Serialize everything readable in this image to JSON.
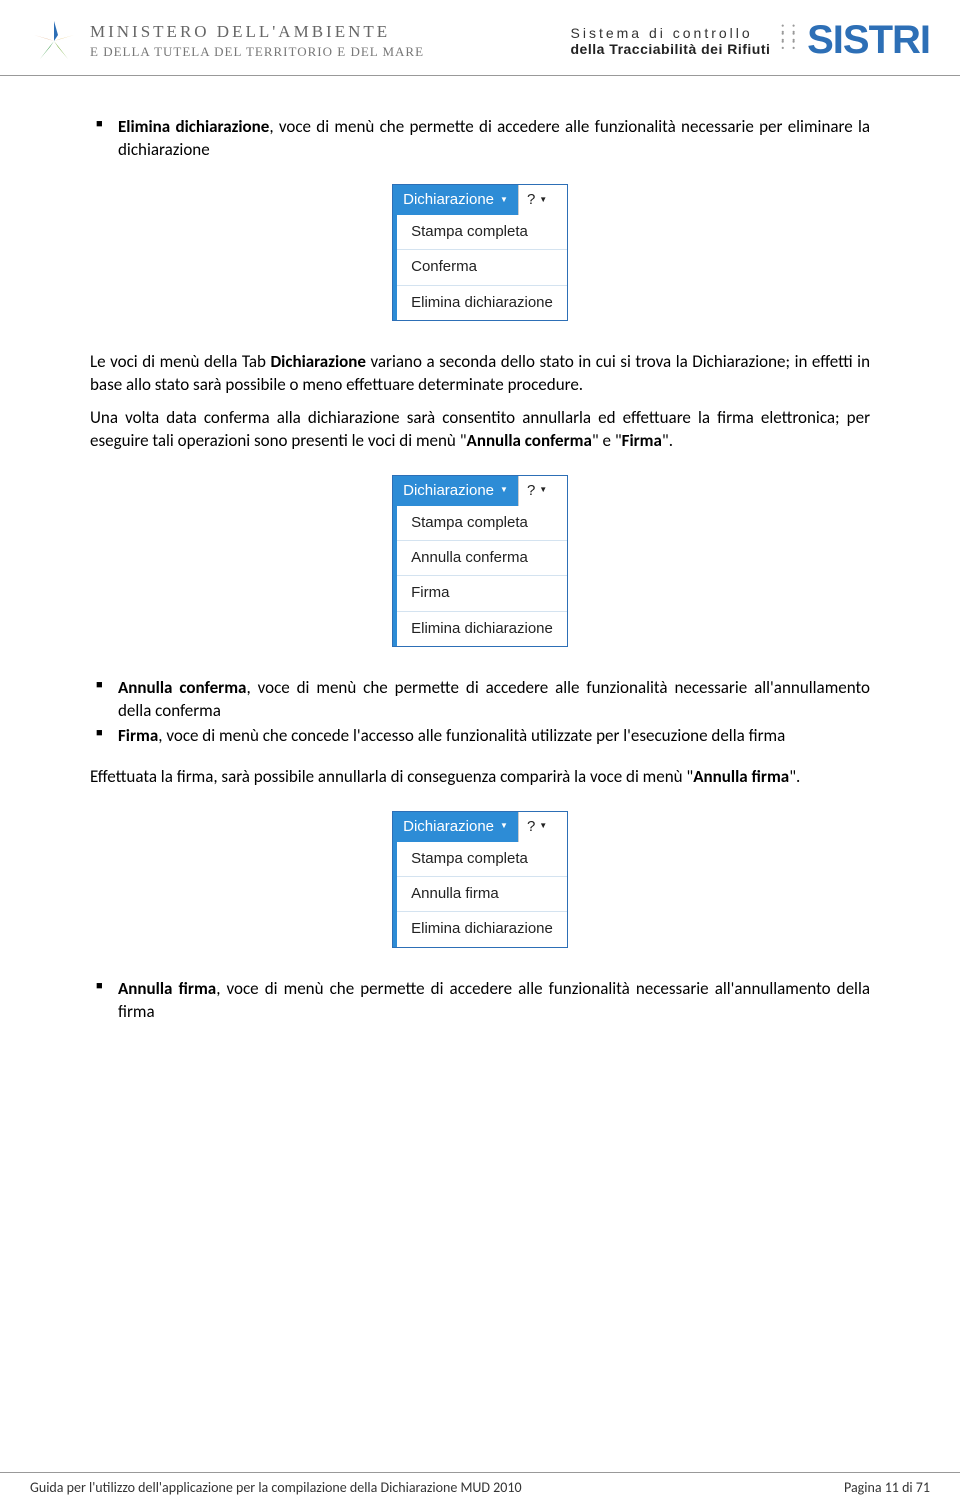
{
  "header": {
    "ministry_line1": "MINISTERO DELL'AMBIENTE",
    "ministry_line2": "E DELLA TUTELA DEL TERRITORIO E DEL MARE",
    "sistri_sub1": "Sistema di controllo",
    "sistri_sub2": "della Tracciabilità dei Rifiuti",
    "sistri_logo": "SISTRI"
  },
  "bullet1": {
    "bold": "Elimina dichiarazione",
    "rest": ", voce di menù che permette di accedere alle funzionalità necessarie per eliminare la dichiarazione"
  },
  "menu1": {
    "tab": "Dichiarazione",
    "help": "?",
    "items": [
      "Stampa completa",
      "Conferma",
      "Elimina dichiarazione"
    ]
  },
  "para1_a": "Le voci di menù della Tab ",
  "para1_b": "Dichiarazione",
  "para1_c": " variano a seconda dello stato in cui si trova la Dichiarazione; in effetti in base allo stato sarà possibile o meno effettuare determinate procedure.",
  "para2_a": "Una volta data conferma alla dichiarazione sarà consentito annullarla ed effettuare la firma elettronica; per eseguire tali operazioni sono presenti le voci di menù \"",
  "para2_b": "Annulla conferma",
  "para2_c": "\" e \"",
  "para2_d": "Firma",
  "para2_e": "\".",
  "menu2": {
    "tab": "Dichiarazione",
    "help": "?",
    "items": [
      "Stampa completa",
      "Annulla conferma",
      "Firma",
      "Elimina dichiarazione"
    ]
  },
  "bullet2": {
    "bold": "Annulla conferma",
    "rest": ", voce di menù che permette di accedere alle funzionalità necessarie all'annullamento della conferma"
  },
  "bullet3": {
    "bold": "Firma",
    "rest": ", voce di menù che concede l'accesso alle funzionalità utilizzate per l'esecuzione della firma"
  },
  "para3_a": "Effettuata la firma, sarà possibile annullarla di conseguenza comparirà la voce di menù \"",
  "para3_b": "Annulla firma",
  "para3_c": "\".",
  "menu3": {
    "tab": "Dichiarazione",
    "help": "?",
    "items": [
      "Stampa completa",
      "Annulla firma",
      "Elimina dichiarazione"
    ]
  },
  "bullet4": {
    "bold": "Annulla firma",
    "rest": ", voce di menù che permette di accedere alle funzionalità necessarie all'annullamento della firma"
  },
  "footer": {
    "left": "Guida per l'utilizzo dell'applicazione per la compilazione della Dichiarazione MUD 2010",
    "right": "Pagina 11 di 71"
  }
}
